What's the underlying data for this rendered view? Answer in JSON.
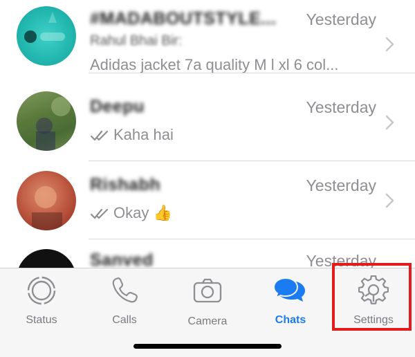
{
  "chats": [
    {
      "name": "#MADABOUTSTYLE...",
      "time": "Yesterday",
      "sender": "Rahul Bhai Bir:",
      "preview": "Adidas jacket 7a quality  M l xl 6 col..."
    },
    {
      "name": "Deepu",
      "time": "Yesterday",
      "preview": "Kaha hai"
    },
    {
      "name": "Rishabh",
      "time": "Yesterday",
      "preview": "Okay",
      "emoji": "👍"
    },
    {
      "name": "Sanved",
      "time": "Yesterday"
    }
  ],
  "tabs": [
    {
      "label": "Status",
      "icon": "status-icon"
    },
    {
      "label": "Calls",
      "icon": "phone-icon"
    },
    {
      "label": "Camera",
      "icon": "camera-icon"
    },
    {
      "label": "Chats",
      "icon": "chats-icon",
      "active": true
    },
    {
      "label": "Settings",
      "icon": "gear-icon"
    }
  ],
  "colors": {
    "accent": "#1a7cf0",
    "tab_inactive": "#7a7a80",
    "timestamp": "#8e8e93",
    "highlight": "#e31b1b",
    "read_ticks": "#8e8e93"
  }
}
